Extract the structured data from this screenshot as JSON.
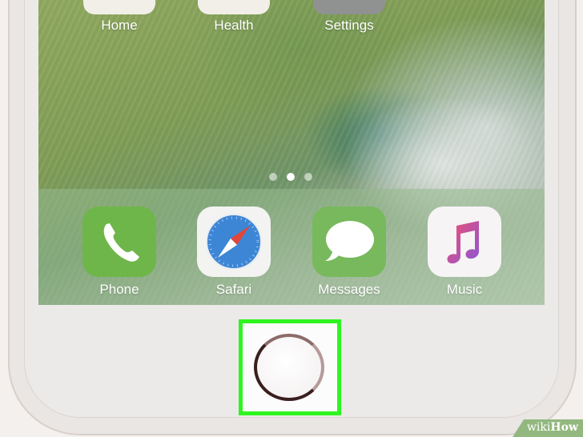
{
  "top_row": {
    "apps": [
      {
        "label": "Home"
      },
      {
        "label": "Health"
      },
      {
        "label": "Settings"
      }
    ]
  },
  "page_indicator": {
    "total": 3,
    "active_index": 1
  },
  "dock": {
    "apps": [
      {
        "label": "Phone",
        "icon": "phone-icon"
      },
      {
        "label": "Safari",
        "icon": "compass-icon"
      },
      {
        "label": "Messages",
        "icon": "speech-bubble-icon"
      },
      {
        "label": "Music",
        "icon": "music-note-icon"
      }
    ]
  },
  "home_button": {
    "highlight_color": "#2ef520"
  },
  "watermark": {
    "part1": "wiki",
    "part2": "How"
  }
}
